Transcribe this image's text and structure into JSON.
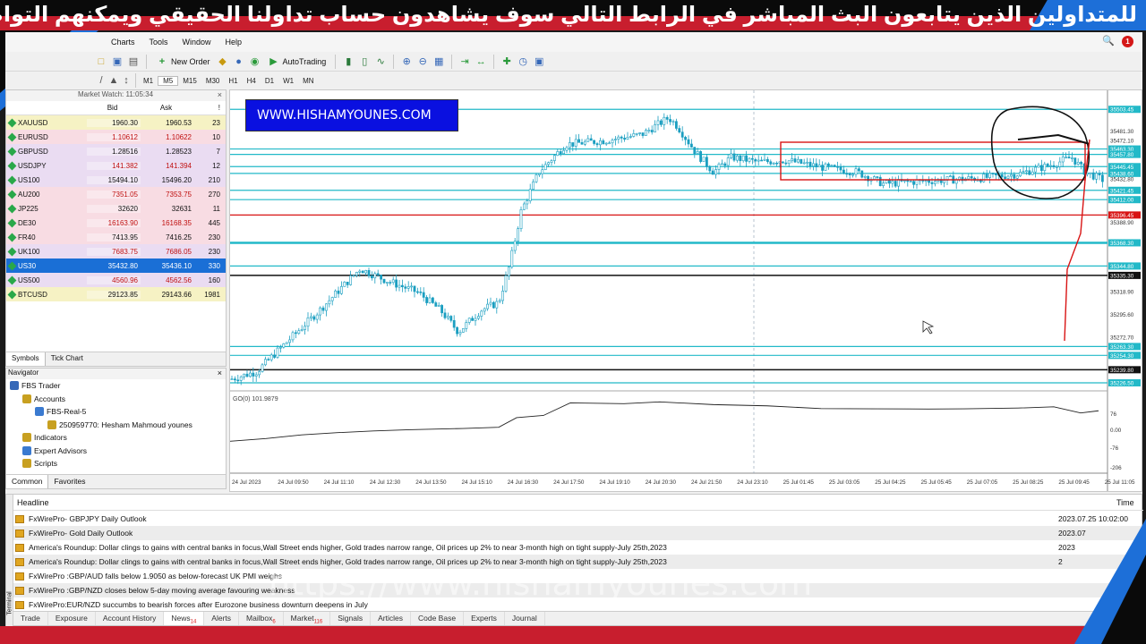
{
  "banner": {
    "text": "للمتداولين الذين يتابعون البث المباشر في الرابط التالي سوف يشاهدون حساب تداولنا الحقيقي ويمكنهم التواصل معنا"
  },
  "menu": [
    "Charts",
    "Tools",
    "Window",
    "Help"
  ],
  "toolbar": {
    "new_order": "New Order",
    "autotrading": "AutoTrading"
  },
  "timeframes": [
    "M1",
    "M5",
    "M15",
    "M30",
    "H1",
    "H4",
    "D1",
    "W1",
    "MN"
  ],
  "market_watch": {
    "title": "Market Watch: 11:05:34",
    "headers": {
      "symbol": "",
      "bid": "Bid",
      "ask": "Ask",
      "spread": "!"
    },
    "rows": [
      {
        "symbol": "XAUUSD",
        "bid": "1960.30",
        "ask": "1960.53",
        "spread": "23"
      },
      {
        "symbol": "EURUSD",
        "bid": "1.10612",
        "ask": "1.10622",
        "spread": "10"
      },
      {
        "symbol": "GBPUSD",
        "bid": "1.28516",
        "ask": "1.28523",
        "spread": "7"
      },
      {
        "symbol": "USDJPY",
        "bid": "141.382",
        "ask": "141.394",
        "spread": "12"
      },
      {
        "symbol": "US100",
        "bid": "15494.10",
        "ask": "15496.20",
        "spread": "210"
      },
      {
        "symbol": "AU200",
        "bid": "7351.05",
        "ask": "7353.75",
        "spread": "270"
      },
      {
        "symbol": "JP225",
        "bid": "32620",
        "ask": "32631",
        "spread": "11"
      },
      {
        "symbol": "DE30",
        "bid": "16163.90",
        "ask": "16168.35",
        "spread": "445"
      },
      {
        "symbol": "FR40",
        "bid": "7413.95",
        "ask": "7416.25",
        "spread": "230"
      },
      {
        "symbol": "UK100",
        "bid": "7683.75",
        "ask": "7686.05",
        "spread": "230"
      },
      {
        "symbol": "US30",
        "bid": "35432.80",
        "ask": "35436.10",
        "spread": "330"
      },
      {
        "symbol": "US500",
        "bid": "4560.96",
        "ask": "4562.56",
        "spread": "160"
      },
      {
        "symbol": "BTCUSD",
        "bid": "29123.85",
        "ask": "29143.66",
        "spread": "1981"
      }
    ],
    "row_colors": [
      "#f6f2c4",
      "#f8dce3",
      "#eadcf2",
      "#eadcf2",
      "#eadcf2",
      "#f8dce3",
      "#f8dce3",
      "#f8dce3",
      "#f8dce3",
      "#eadcf2",
      "#1a6fd6",
      "#eadcf2",
      "#f6f2c4"
    ],
    "selected_index": 10,
    "tabs": [
      "Symbols",
      "Tick Chart"
    ]
  },
  "navigator": {
    "title": "Navigator",
    "items": [
      {
        "label": "FBS Trader",
        "indent": 0
      },
      {
        "label": "Accounts",
        "indent": 1
      },
      {
        "label": "FBS-Real-5",
        "indent": 2
      },
      {
        "label": "250959770: Hesham Mahmoud younes",
        "indent": 3
      },
      {
        "label": "Indicators",
        "indent": 1
      },
      {
        "label": "Expert Advisors",
        "indent": 1
      },
      {
        "label": "Scripts",
        "indent": 1
      }
    ],
    "tabs": [
      "Common",
      "Favorites"
    ]
  },
  "chart": {
    "watermark": "WWW.HISHAMYOUNES.COM",
    "oscillator_label": "GO(0) 101.9879",
    "price_labels": [
      "35503.45",
      "35481.30",
      "35472.10",
      "35463.30",
      "35457.80",
      "35445.45",
      "35438.60",
      "35432.80",
      "35421.45",
      "35412.00",
      "35396.45",
      "35388.90",
      "35368.30",
      "35344.80",
      "35335.30",
      "35318.90",
      "35295.60",
      "35272.70",
      "35263.30",
      "35254.30",
      "35239.80",
      "35226.50"
    ],
    "osc_labels": [
      "76",
      "0.00",
      "-76",
      "-206"
    ],
    "time_labels": [
      "24 Jul 2023",
      "24 Jul 09:50",
      "24 Jul 11:10",
      "24 Jul 12:30",
      "24 Jul 13:50",
      "24 Jul 15:10",
      "24 Jul 16:30",
      "24 Jul 17:50",
      "24 Jul 19:10",
      "24 Jul 20:30",
      "24 Jul 21:50",
      "24 Jul 23:10",
      "25 Jul 01:45",
      "25 Jul 03:05",
      "25 Jul 04:25",
      "25 Jul 05:45",
      "25 Jul 07:05",
      "25 Jul 08:25",
      "25 Jul 09:45",
      "25 Jul 11:05"
    ]
  },
  "news": {
    "headers": {
      "headline": "Headline",
      "time": "Time"
    },
    "rows": [
      {
        "headline": "FxWirePro- GBPJPY Daily Outlook",
        "time": "2023.07.25 10:02:00"
      },
      {
        "headline": "FxWirePro- Gold Daily Outlook",
        "time": "2023.07"
      },
      {
        "headline": "America's Roundup: Dollar clings to gains with central banks in focus,Wall Street ends higher, Gold trades narrow range, Oil prices up 2% to near 3-month high on tight supply-July 25th,2023",
        "time": "2023"
      },
      {
        "headline": "America's Roundup: Dollar clings to gains with central banks in focus,Wall Street ends higher, Gold trades narrow range, Oil prices up 2% to near 3-month high on tight supply-July 25th,2023",
        "time": "2"
      },
      {
        "headline": "FxWirePro :GBP/AUD falls below 1.9050 as below-forecast UK PMI weighs",
        "time": ""
      },
      {
        "headline": "FxWirePro :GBP/NZD closes below 5-day moving average favouring weakness",
        "time": ""
      },
      {
        "headline": "FxWirePro:EUR/NZD succumbs to bearish forces after Eurozone business downturn deepens in July",
        "time": ""
      }
    ]
  },
  "terminal_tabs": [
    {
      "label": "Trade",
      "badge": ""
    },
    {
      "label": "Exposure",
      "badge": ""
    },
    {
      "label": "Account History",
      "badge": ""
    },
    {
      "label": "News",
      "badge": "14"
    },
    {
      "label": "Alerts",
      "badge": ""
    },
    {
      "label": "Mailbox",
      "badge": "6"
    },
    {
      "label": "Market",
      "badge": "116"
    },
    {
      "label": "Signals",
      "badge": ""
    },
    {
      "label": "Articles",
      "badge": ""
    },
    {
      "label": "Code Base",
      "badge": ""
    },
    {
      "label": "Experts",
      "badge": ""
    },
    {
      "label": "Journal",
      "badge": ""
    }
  ],
  "terminal_side_label": "Terminal",
  "url_overlay": "https://www.hishamyounes.com",
  "colors": {
    "accent_blue": "#1d6fd8",
    "banner_red": "#c81e2e",
    "line_red": "#d81414",
    "line_cyan": "#22b9c8",
    "candle": "#1a9ec0"
  }
}
